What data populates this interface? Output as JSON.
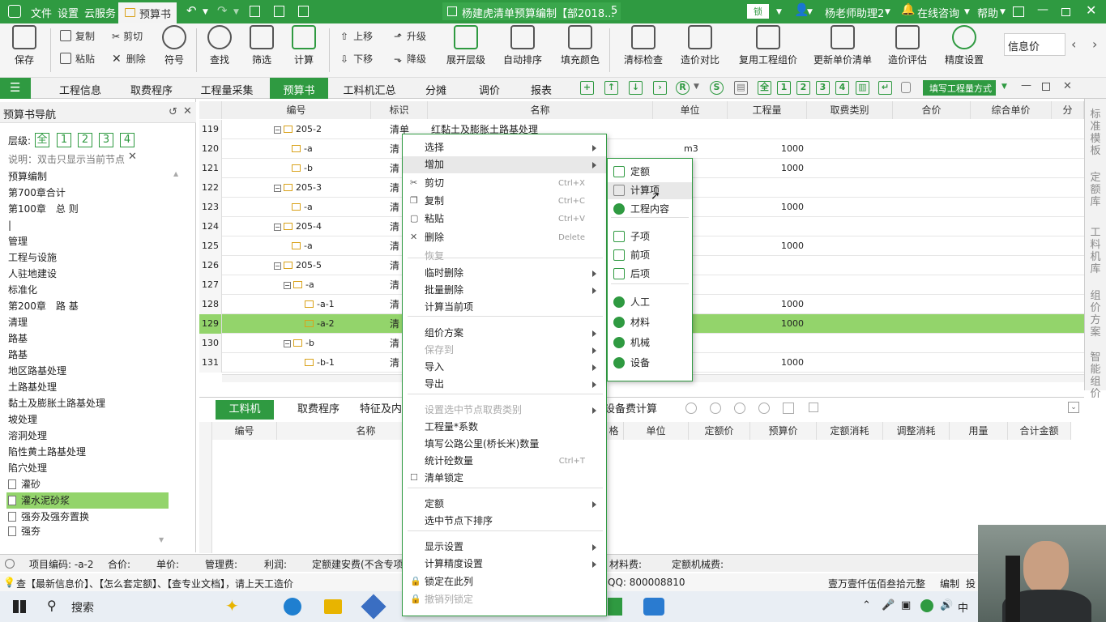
{
  "titlebar": {
    "menus": [
      "文件",
      "设置",
      "云服务"
    ],
    "active_tab": "预算书",
    "document_title": "杨建虎清单预算编制【部2018...",
    "doc_tab_num": "5",
    "lock_label": "锁",
    "user": "杨老师助理2",
    "online": "在线咨询",
    "help": "帮助"
  },
  "ribbon": {
    "save": "保存",
    "copy": "复制",
    "cut": "剪切",
    "paste": "粘贴",
    "delete": "删除",
    "symbol": "符号",
    "find": "查找",
    "filter": "筛选",
    "calc": "计算",
    "move_up": "上移",
    "move_down": "下移",
    "upgrade": "升级",
    "downgrade": "降级",
    "expand_level": "展开层级",
    "auto_sort": "自动排序",
    "fill_color": "填充颜色",
    "check_list": "清标检查",
    "price_compare": "造价对比",
    "reuse_group": "复用工程组价",
    "update_price": "更新单价清单",
    "price_eval": "造价评估",
    "precision": "精度设置",
    "info_price": "信息价"
  },
  "main_tabs": [
    "工程信息",
    "取费程序",
    "工程量采集",
    "预算书",
    "工料机汇总",
    "分摊",
    "调价",
    "报表"
  ],
  "toolbar_right": {
    "fill_button": "填写工程量方式",
    "level_nums": [
      "全",
      "1",
      "2",
      "3",
      "4"
    ]
  },
  "nav": {
    "title": "预算书导航",
    "level_label": "层级:",
    "level_buttons": [
      "全",
      "1",
      "2",
      "3",
      "4"
    ],
    "hint": "说明：双击只显示当前节点",
    "items": [
      "预算编制",
      "第700章合计",
      "第100章　总 则",
      "|",
      "管理",
      "工程与设施",
      "人驻地建设",
      "标准化",
      "第200章　路 基",
      "清理",
      "路基",
      "路基",
      "地区路基处理",
      "土路基处理",
      "黏土及膨胀土路基处理",
      "坡处理",
      "溶洞处理",
      "陷性黄土路基处理",
      "陷穴处理",
      "灌砂",
      "灌水泥砂浆",
      "强夯及强夯置换",
      "强夯"
    ],
    "selected_item": "灌水泥砂浆"
  },
  "grid": {
    "headers": [
      "编号",
      "标识",
      "名称",
      "单位",
      "工程量",
      "取费类别",
      "合价",
      "综合单价",
      "分"
    ],
    "rows": [
      {
        "rn": "119",
        "code": "205-2",
        "flag": "清单",
        "name": "红黏土及膨胀土路基处理",
        "unit": "",
        "qty": ""
      },
      {
        "rn": "120",
        "code": "-a",
        "flag": "清",
        "name": "",
        "unit": "m3",
        "qty": "1000"
      },
      {
        "rn": "121",
        "code": "-b",
        "flag": "清",
        "name": "",
        "unit": "",
        "qty": "1000"
      },
      {
        "rn": "122",
        "code": "205-3",
        "flag": "清",
        "name": "",
        "unit": "",
        "qty": ""
      },
      {
        "rn": "123",
        "code": "-a",
        "flag": "清",
        "name": "",
        "unit": "",
        "qty": "1000"
      },
      {
        "rn": "124",
        "code": "205-4",
        "flag": "清",
        "name": "",
        "unit": "",
        "qty": ""
      },
      {
        "rn": "125",
        "code": "-a",
        "flag": "清",
        "name": "",
        "unit": "",
        "qty": "1000"
      },
      {
        "rn": "126",
        "code": "205-5",
        "flag": "清",
        "name": "",
        "unit": "",
        "qty": ""
      },
      {
        "rn": "127",
        "code": "-a",
        "flag": "清",
        "name": "",
        "unit": "",
        "qty": ""
      },
      {
        "rn": "128",
        "code": "-a-1",
        "flag": "清",
        "name": "",
        "unit": "",
        "qty": "1000"
      },
      {
        "rn": "129",
        "code": "-a-2",
        "flag": "清",
        "name": "",
        "unit": "",
        "qty": "1000"
      },
      {
        "rn": "130",
        "code": "-b",
        "flag": "清",
        "name": "",
        "unit": "",
        "qty": ""
      },
      {
        "rn": "131",
        "code": "-b-1",
        "flag": "清",
        "name": "",
        "unit": "",
        "qty": "1000"
      }
    ]
  },
  "bottom_panel": {
    "tabs": [
      "工料机",
      "取费程序",
      "特征及内",
      "设备费计算"
    ],
    "headers": [
      "编号",
      "名称",
      "格",
      "单位",
      "定额价",
      "预算价",
      "定额消耗",
      "调整消耗",
      "用量",
      "合计金额"
    ]
  },
  "status": {
    "item_code": "项目编码: -a-2",
    "total": "合价:",
    "unit_price": "单价:",
    "mgmt_fee": "管理费:",
    "profit": "利润:",
    "install_fee": "定额建安费(不含专项",
    "material_fee": "材料费:",
    "machine_fee": "定额机械费:",
    "tip": "查【最新信息价】、【怎么套定额】、【查专业文档】，请上天工造价",
    "qq": "QQ: 800008810",
    "amount_words": "壹万壹仟伍佰叁拾元整",
    "edit": "编制",
    "extra": "投"
  },
  "taskbar": {
    "search": "搜索"
  },
  "right_tabs": [
    "标准模板",
    "定额库",
    "工料机库",
    "组价方案",
    "智能组价"
  ],
  "context_menu": {
    "items": [
      {
        "label": "选择",
        "shortcut": "",
        "arrow": true,
        "disabled": false
      },
      {
        "label": "增加",
        "shortcut": "",
        "arrow": true,
        "disabled": false
      },
      {
        "label": "剪切",
        "shortcut": "Ctrl+X",
        "arrow": false,
        "disabled": false
      },
      {
        "label": "复制",
        "shortcut": "Ctrl+C",
        "arrow": false,
        "disabled": false
      },
      {
        "label": "粘贴",
        "shortcut": "Ctrl+V",
        "arrow": false,
        "disabled": false
      },
      {
        "label": "删除",
        "shortcut": "Delete",
        "arrow": false,
        "disabled": false
      },
      {
        "label": "恢复",
        "shortcut": "",
        "arrow": false,
        "disabled": true
      },
      {
        "label": "临时删除",
        "shortcut": "",
        "arrow": true,
        "disabled": false
      },
      {
        "label": "批量删除",
        "shortcut": "",
        "arrow": true,
        "disabled": false
      },
      {
        "label": "计算当前项",
        "shortcut": "",
        "arrow": false,
        "disabled": false
      },
      {
        "label": "组价方案",
        "shortcut": "",
        "arrow": true,
        "disabled": false
      },
      {
        "label": "保存到",
        "shortcut": "",
        "arrow": true,
        "disabled": true
      },
      {
        "label": "导入",
        "shortcut": "",
        "arrow": true,
        "disabled": false
      },
      {
        "label": "导出",
        "shortcut": "",
        "arrow": true,
        "disabled": false
      },
      {
        "label": "设置选中节点取费类别",
        "shortcut": "",
        "arrow": true,
        "disabled": true
      },
      {
        "label": "工程量*系数",
        "shortcut": "",
        "arrow": false,
        "disabled": false
      },
      {
        "label": "填写公路公里(桥长米)数量",
        "shortcut": "",
        "arrow": false,
        "disabled": false
      },
      {
        "label": "统计砼数量",
        "shortcut": "Ctrl+T",
        "arrow": false,
        "disabled": false
      },
      {
        "label": "清单锁定",
        "shortcut": "",
        "arrow": false,
        "disabled": false
      },
      {
        "label": "定额",
        "shortcut": "",
        "arrow": true,
        "disabled": false
      },
      {
        "label": "选中节点下排序",
        "shortcut": "",
        "arrow": false,
        "disabled": false
      },
      {
        "label": "显示设置",
        "shortcut": "",
        "arrow": true,
        "disabled": false
      },
      {
        "label": "计算精度设置",
        "shortcut": "",
        "arrow": true,
        "disabled": false
      },
      {
        "label": "锁定在此列",
        "shortcut": "",
        "arrow": false,
        "disabled": false
      },
      {
        "label": "撤销列锁定",
        "shortcut": "",
        "arrow": false,
        "disabled": true
      }
    ]
  },
  "submenu": {
    "items": [
      "定额",
      "计算项",
      "工程内容",
      "子项",
      "前项",
      "后项",
      "人工",
      "材料",
      "机械",
      "设备"
    ],
    "hovered": "计算项"
  },
  "colors": {
    "brand": "#2f9a41",
    "selected_row": "#93d46b"
  }
}
